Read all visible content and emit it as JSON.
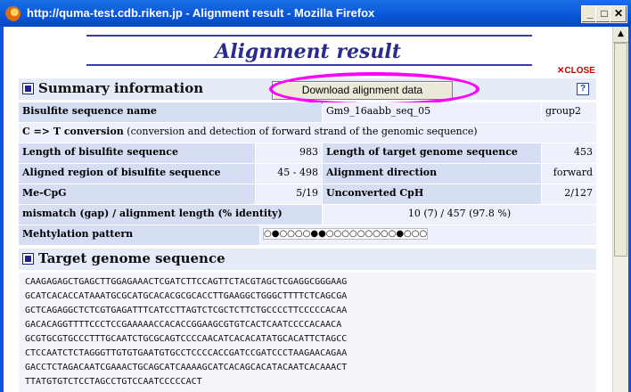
{
  "window": {
    "title": "http://quma-test.cdb.riken.jp - Alignment result - Mozilla Firefox",
    "buttons": [
      "_",
      "□",
      "✕"
    ]
  },
  "page": {
    "title": "Alignment result",
    "close_label": "✕CLOSE"
  },
  "summary": {
    "heading": "Summary information",
    "download_label": "Download alignment data",
    "help_label": "?",
    "bisulfite_name_label": "Bisulfite sequence name",
    "bisulfite_name_value": "Gm9_16aabb_seq_05",
    "group_value": "group2",
    "conversion_label": "C => T conversion",
    "conversion_desc": " (conversion and detection of forward strand of the genomic sequence)",
    "len_bis_label": "Length of bisulfite sequence",
    "len_bis_value": "983",
    "len_target_label": "Length of target genome sequence",
    "len_target_value": "453",
    "aligned_region_label": "Aligned region of bisulfite sequence",
    "aligned_region_value": "45 - 498",
    "direction_label": "Alignment direction",
    "direction_value": "forward",
    "mecpg_label": "Me-CpG",
    "mecpg_value": "5/19",
    "unconv_label": "Unconverted CpH",
    "unconv_value": "2/127",
    "mismatch_label": "mismatch (gap) / alignment length (% identity)",
    "mismatch_value": "10 (7) / 457 (97.8 %)",
    "pattern_label": "Mehtylation pattern",
    "pattern_value": "○●○○○○●●○○○○○○○○○●○○○"
  },
  "target": {
    "heading": "Target genome sequence",
    "lines": [
      "CAAGAGAGCTGAGCTTGGAGAAACTCGATCTTCCAGTTCTACGTAGCTCGAGGCGGGAAG",
      "GCATCACACCATAAATGCGCATGCACACGCGCACCTTGAAGGCTGGGCTTTTCTCAGCGA",
      "GCTCAGAGGCTCTCGTGAGATTTCATCCTTAGTCTCGCTCTTCTGCCCCTTCCCCCACAA",
      "GACACAGGTTTTCCCTCCGAAAAACCACACCGGAAGCGTGTCACTCAATCCCCACAACA",
      "GCGTGCGTGCCCTTTGCAATCTGCGCAGTCCCCAACATCACACATATGCACATTCTAGCC",
      "CTCCAATCTCTAGGGTTGTGTGAATGTGCCTCCCCACCGATCCGATCCCTAAGAACAGAA",
      "GACCTCTAGACAATCGAAACTGCAGCATCAAAAGCATCACAGCACATACAATCACAAACT",
      "TTATGTGTCTCCTAGCCTGTCCAATCCCCCACT"
    ]
  }
}
